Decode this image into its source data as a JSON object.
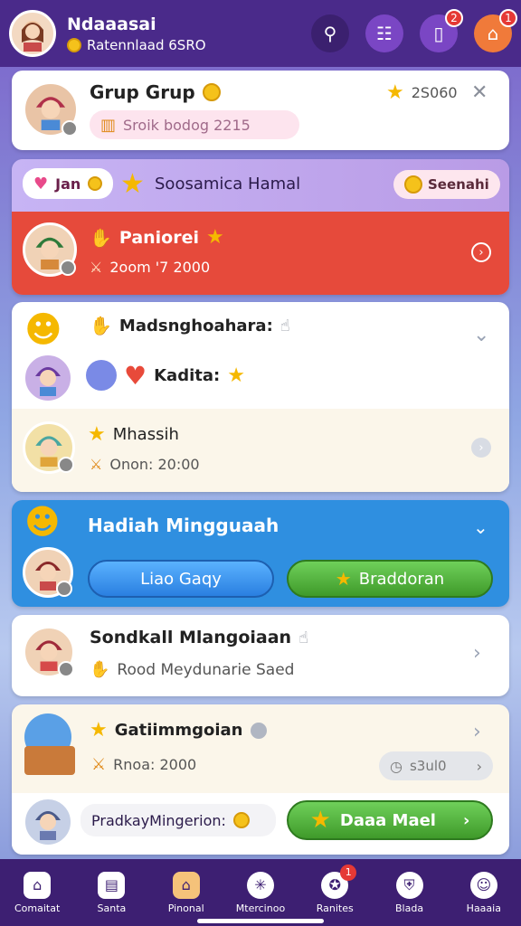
{
  "header": {
    "name": "Ndaaasai",
    "subtitle": "Ratennlaad 6SRO",
    "notif_a": "2",
    "notif_b": "1"
  },
  "cards": {
    "grup": {
      "title": "Grup Grup",
      "points": "2S060",
      "input_text": "Sroik bodog 2215",
      "close": "✕"
    },
    "banner": {
      "chip": "Jan",
      "title": "Soosamica Hamal",
      "button": "Seenahi"
    },
    "red": {
      "title": "Paniorei",
      "sub": "2oom '7 2000"
    },
    "group3": {
      "row1_title": "Madsnghoahara:",
      "row2_title": "Kadita:",
      "row3_title": "Mhassih",
      "row3_sub": "Onon: 20:00"
    },
    "blue": {
      "title": "Hadiah Mingguaah",
      "btn_left": "Liao Gaqy",
      "btn_right": "Braddoran"
    },
    "sond": {
      "title": "Sondkall Mlangoiaan",
      "sub": "Rood Meydunarie Saed"
    },
    "gati": {
      "title": "Gatiimmgoian",
      "sub": "Rnoa: 2000",
      "timer": "s3ul0",
      "footer_text": "PradkayMingerion:",
      "footer_button": "Daaa Mael"
    }
  },
  "tabs": [
    {
      "label": "Comaitat"
    },
    {
      "label": "Santa"
    },
    {
      "label": "Pinonal"
    },
    {
      "label": "Mtercinoo"
    },
    {
      "label": "Ranites",
      "badge": "1"
    },
    {
      "label": "Blada"
    },
    {
      "label": "Haaaia"
    }
  ],
  "colors": {
    "header": "#4a2a8a",
    "red_card": "#e64a3b",
    "blue_card": "#2f8fe0",
    "green_button": "#4caf33",
    "tabbar": "#3d1f72"
  }
}
